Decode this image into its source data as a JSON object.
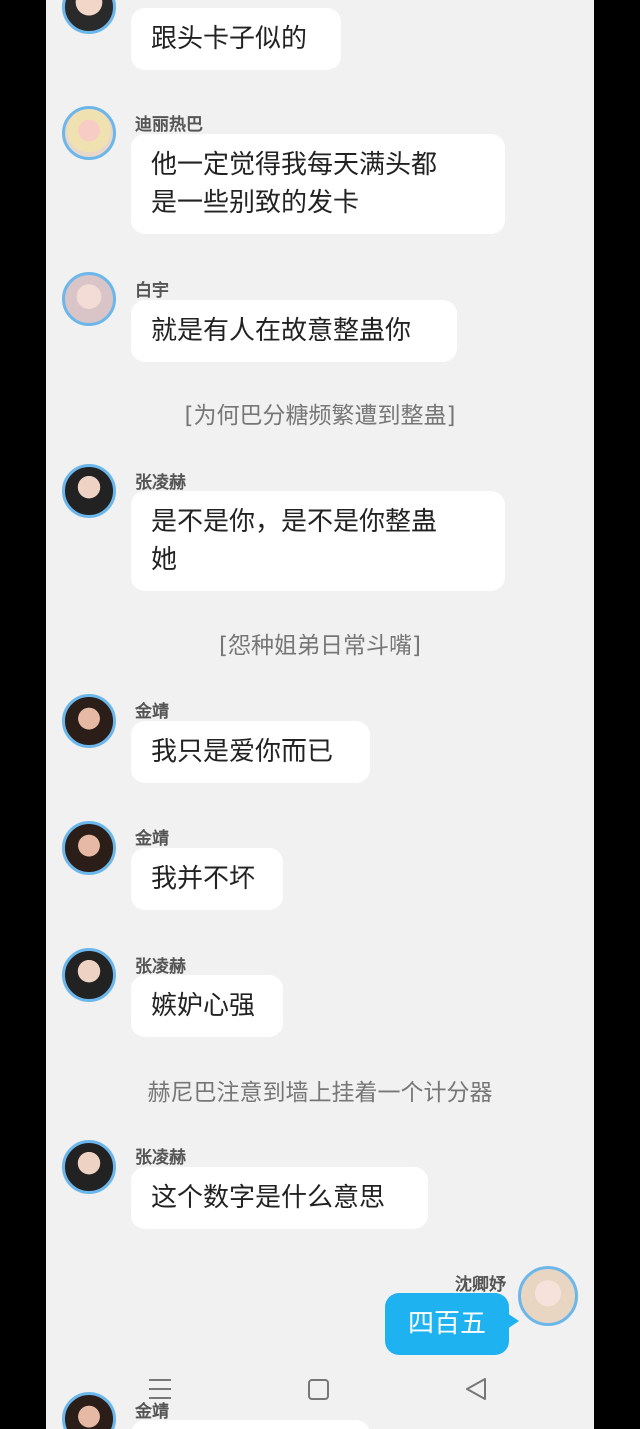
{
  "messages": [
    {
      "name": "",
      "text": [
        "跟头卡子似的"
      ]
    },
    {
      "name": "迪丽热巴",
      "text": [
        "他一定觉得我每天满头都",
        "是一些别致的发卡"
      ]
    },
    {
      "name": "白宇",
      "text": [
        "就是有人在故意整蛊你"
      ]
    },
    {
      "narration": "[为何巴分糖频繁遭到整蛊]"
    },
    {
      "name": "张凌赫",
      "text": [
        "是不是你，是不是你整蛊",
        "她"
      ]
    },
    {
      "narration": "[怨种姐弟日常斗嘴]"
    },
    {
      "name": "金靖",
      "text": [
        "我只是爱你而已"
      ]
    },
    {
      "name": "金靖",
      "text": [
        "我并不坏"
      ]
    },
    {
      "name": "张凌赫",
      "text": [
        "嫉妒心强"
      ]
    },
    {
      "narration": "赫尼巴注意到墙上挂着一个计分器"
    },
    {
      "name": "张凌赫",
      "text": [
        "这个数字是什么意思"
      ]
    },
    {
      "name": "沈卿妤",
      "text": [
        "四百五"
      ],
      "self": true
    },
    {
      "name": "金靖",
      "text": [
        ""
      ]
    }
  ],
  "nav": {
    "menu_icon": "menu-icon",
    "home_icon": "square-home-icon",
    "back_icon": "triangle-back-icon"
  },
  "colors": {
    "background": "#f1f1f1",
    "self_bubble": "#1fb2f0",
    "avatar_ring": "#6bb6ea"
  }
}
